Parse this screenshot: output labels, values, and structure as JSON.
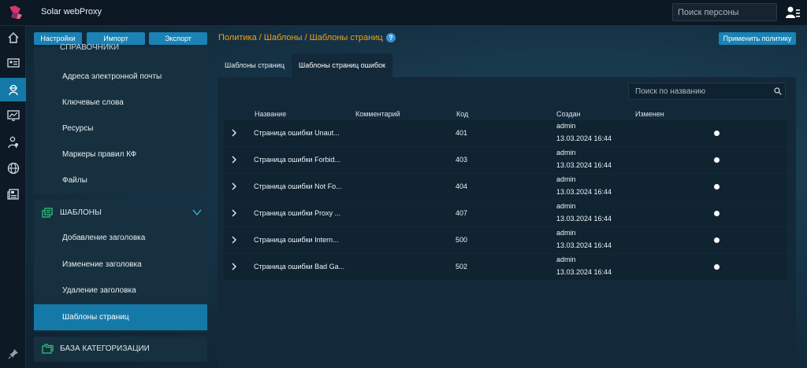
{
  "app": {
    "title": "Solar webProxy"
  },
  "header": {
    "person_search_placeholder": "Поиск персоны"
  },
  "toolbar": {
    "settings_label": "Настройки",
    "import_label": "Импорт",
    "export_label": "Экспорт",
    "breadcrumb": "Политика / Шаблоны / Шаблоны страниц",
    "help_label": "?",
    "apply_label": "Применить политику"
  },
  "rail": {
    "items": [
      "home-icon",
      "id-card-icon",
      "shield-agent-icon",
      "monitor-chart-icon",
      "user-cert-icon",
      "globe-icon",
      "news-icon"
    ],
    "active_index": 2,
    "bottom": "pin-icon"
  },
  "sidebar": {
    "top_section_clipped_label": "СПРАВОЧНИКИ",
    "top_items": [
      "Адреса электронной почты",
      "Ключевые слова",
      "Ресурсы",
      "Маркеры правил КФ",
      "Файлы"
    ],
    "templates_section": {
      "label": "ШАБЛОНЫ",
      "items": [
        "Добавление заголовка",
        "Изменение заголовка",
        "Удаление заголовка",
        "Шаблоны страниц"
      ],
      "active_index": 3
    },
    "categorization_section": {
      "label": "БАЗА КАТЕГОРИЗАЦИИ"
    }
  },
  "tabs": [
    {
      "label": "Шаблоны страниц",
      "active": false
    },
    {
      "label": "Шаблоны страниц ошибок",
      "active": true
    }
  ],
  "table": {
    "search_placeholder": "Поиск по названию",
    "columns": {
      "name": "Название",
      "comment": "Комментарий",
      "code": "Код",
      "created": "Создан",
      "modified": "Изменен"
    },
    "rows": [
      {
        "name": "Страница ошибки Unaut...",
        "comment": "",
        "code": "401",
        "created_by": "admin",
        "created_at": "13.03.2024 16:44"
      },
      {
        "name": "Страница ошибки Forbid...",
        "comment": "",
        "code": "403",
        "created_by": "admin",
        "created_at": "13.03.2024 16:44"
      },
      {
        "name": "Страница ошибки Not Fo...",
        "comment": "",
        "code": "404",
        "created_by": "admin",
        "created_at": "13.03.2024 16:44"
      },
      {
        "name": "Страница ошибки Proxy ...",
        "comment": "",
        "code": "407",
        "created_by": "admin",
        "created_at": "13.03.2024 16:44"
      },
      {
        "name": "Страница ошибки Intern...",
        "comment": "",
        "code": "500",
        "created_by": "admin",
        "created_at": "13.03.2024 16:44"
      },
      {
        "name": "Страница ошибки Bad Ga...",
        "comment": "",
        "code": "502",
        "created_by": "admin",
        "created_at": "13.03.2024 16:44"
      }
    ]
  },
  "colors": {
    "accent": "#1a82b5",
    "breadcrumb": "#f0a31d",
    "active_item": "#1579a8"
  }
}
